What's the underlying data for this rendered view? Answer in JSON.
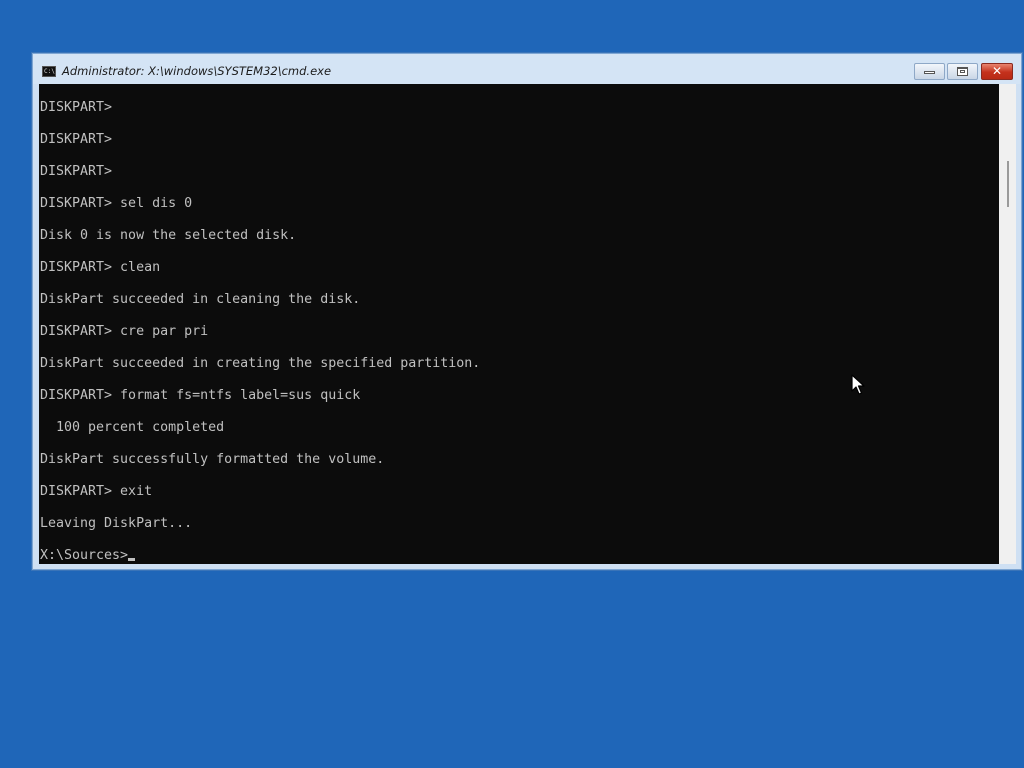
{
  "window": {
    "title": "Administrator: X:\\windows\\SYSTEM32\\cmd.exe",
    "icon": "cmd-icon",
    "buttons": [
      "minimize-icon",
      "maximize-icon",
      "close-icon"
    ]
  },
  "console": {
    "lines": [
      "DISKPART>",
      "DISKPART>",
      "DISKPART>",
      "DISKPART> sel dis 0",
      "Disk 0 is now the selected disk.",
      "DISKPART> clean",
      "DiskPart succeeded in cleaning the disk.",
      "DISKPART> cre par pri",
      "DiskPart succeeded in creating the specified partition.",
      "DISKPART> format fs=ntfs label=sus quick",
      "  100 percent completed",
      "DiskPart successfully formatted the volume.",
      "DISKPART> exit",
      "Leaving DiskPart...",
      "X:\\Sources>"
    ]
  },
  "colors": {
    "desktop": "#1f66b8",
    "console_background": "#0c0c0c",
    "console_text": "#c0c0c0",
    "close_button": "#c4311c"
  }
}
